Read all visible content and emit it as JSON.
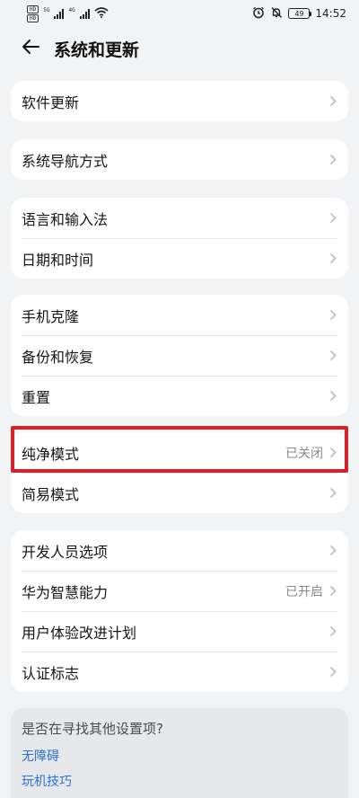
{
  "status_bar": {
    "sim1": "HD",
    "sim2": "HD",
    "net1": "5G",
    "net2": "4G",
    "battery": "49",
    "time": "14:52"
  },
  "header": {
    "title": "系统和更新"
  },
  "groups": [
    {
      "items": [
        {
          "label": "软件更新",
          "value": ""
        }
      ]
    },
    {
      "items": [
        {
          "label": "系统导航方式",
          "value": ""
        }
      ]
    },
    {
      "items": [
        {
          "label": "语言和输入法",
          "value": ""
        },
        {
          "label": "日期和时间",
          "value": ""
        }
      ]
    },
    {
      "items": [
        {
          "label": "手机克隆",
          "value": ""
        },
        {
          "label": "备份和恢复",
          "value": ""
        },
        {
          "label": "重置",
          "value": ""
        }
      ]
    },
    {
      "items": [
        {
          "label": "纯净模式",
          "value": "已关闭"
        },
        {
          "label": "简易模式",
          "value": ""
        }
      ]
    },
    {
      "items": [
        {
          "label": "开发人员选项",
          "value": ""
        },
        {
          "label": "华为智慧能力",
          "value": "已开启"
        },
        {
          "label": "用户体验改进计划",
          "value": ""
        },
        {
          "label": "认证标志",
          "value": ""
        }
      ]
    }
  ],
  "suggest": {
    "title": "是否在寻找其他设置项?",
    "links": [
      "无障碍",
      "玩机技巧"
    ]
  },
  "colors": {
    "background": "#f1f3f5",
    "card": "#ffffff",
    "highlight": "#d4222b",
    "link": "#2a6fdb"
  }
}
